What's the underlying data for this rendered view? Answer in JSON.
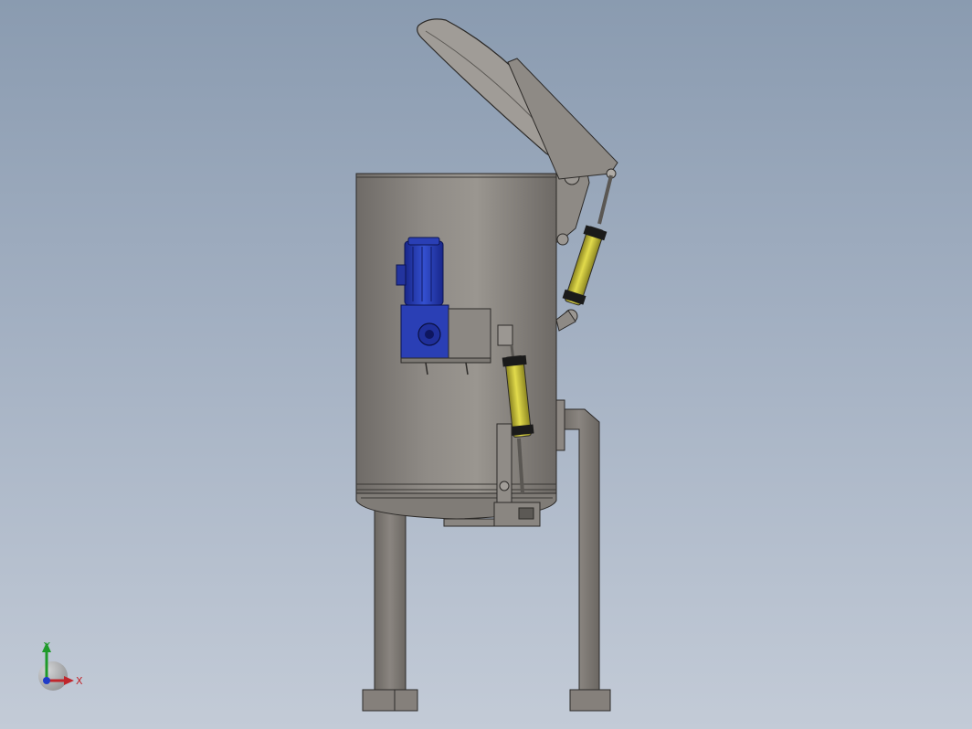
{
  "viewport": {
    "background_top": "#8a9bb0",
    "background_bottom": "#c3cbd7"
  },
  "model": {
    "tank_color": "#8f8b86",
    "leg_color": "#7f7a74",
    "motor_color": "#2a3fb5",
    "cylinder_color": "#d4cd3a",
    "clamp_color": "#1a1a1a"
  },
  "triad": {
    "x_label": "X",
    "y_label": "Y",
    "x_color": "#c0262c",
    "y_color": "#1f9a2a",
    "z_color": "#1f3cc8"
  }
}
